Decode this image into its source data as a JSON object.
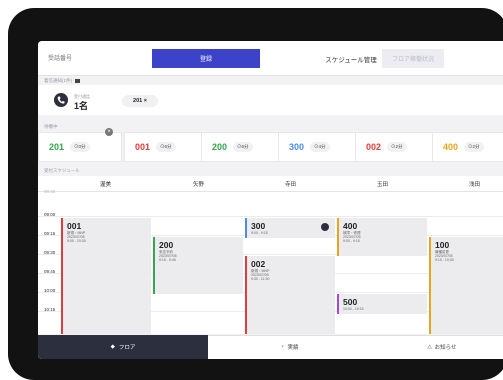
{
  "topbar": {
    "number_placeholder": "受話番号",
    "register_label": "登録",
    "tab_schedule": "スケジュール管理",
    "tab_floor_status": "フロア稼働状況"
  },
  "reception": {
    "section_label": "着信通知(1件)",
    "call_caption": "受付通話",
    "call_count": "1名",
    "waiting_chip": "201 ×"
  },
  "waiting": {
    "section_label": "待機中",
    "cards": [
      {
        "code": "201",
        "time": "0分",
        "color": "#33a84a"
      },
      {
        "code": "001",
        "time": "6分",
        "color": "#e43a3a"
      },
      {
        "code": "200",
        "time": "6分",
        "color": "#33a84a"
      },
      {
        "code": "300",
        "time": "4分",
        "color": "#4b8de0"
      },
      {
        "code": "002",
        "time": "2分",
        "color": "#e43a3a"
      },
      {
        "code": "400",
        "time": "2分",
        "color": "#e8a51b"
      }
    ]
  },
  "schedule": {
    "section_label": "受付スケジュール",
    "staff": [
      "渥美",
      "矢野",
      "寺田",
      "玉田",
      "浅田"
    ],
    "times": [
      "09:00",
      "09:15",
      "09:30",
      "09:45",
      "10:00",
      "10:15"
    ],
    "appointments": [
      {
        "code": "001",
        "line1": "新規・MNP",
        "line2": "2023/07/05",
        "line3": "9:00 - 10:30",
        "color": "#e43a3a"
      },
      {
        "code": "200",
        "line1": "来店予約",
        "line2": "2023/07/05",
        "line3": "9:15 - 9:45",
        "color": "#33a84a"
      },
      {
        "code": "300",
        "line1": "9:00 - 9:15",
        "line2": "",
        "line3": "",
        "color": "#4b8de0"
      },
      {
        "code": "002",
        "line1": "新規・MNP",
        "line2": "2023/07/05",
        "line3": "9:30 - 11:30",
        "color": "#e43a3a"
      },
      {
        "code": "400",
        "line1": "故障・修理",
        "line2": "2023/07/05",
        "line3": "9:00 - 9:15",
        "color": "#e8a51b"
      },
      {
        "code": "100",
        "line1": "機種変更",
        "line2": "2023/07/05",
        "line3": "9:15 - 10:30",
        "color": "#e8a51b"
      },
      {
        "code": "500",
        "line1": "10:00 - 10:15",
        "line2": "",
        "line3": "",
        "color": "#a64ad6"
      }
    ]
  },
  "nav": {
    "floor": "フロア",
    "staff": "実績",
    "notice": "お知らせ"
  }
}
